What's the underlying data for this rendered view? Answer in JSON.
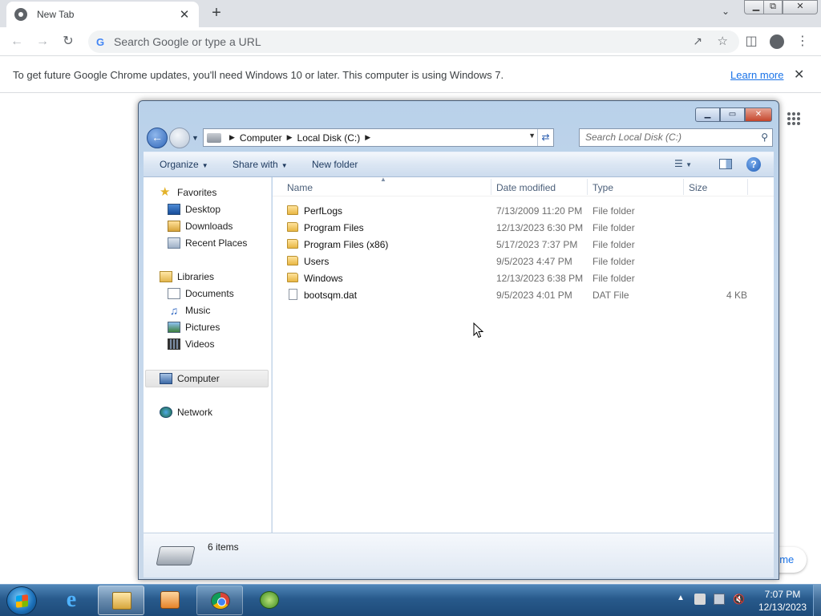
{
  "chrome": {
    "tab_title": "New Tab",
    "tab_close": "✕",
    "new_tab": "+",
    "omnibox_placeholder": "Search Google or type a URL",
    "omnibox_g": "G",
    "window_buttons": {
      "minimize": "▁",
      "restore": "⧉",
      "close": "✕"
    },
    "infobar": {
      "message": "To get future Google Chrome updates, you'll need Windows 10 or later. This computer is using Windows 7.",
      "link": "Learn more",
      "close": "✕"
    },
    "customize_chip": "ome"
  },
  "explorer": {
    "caption": {
      "minimize": "▁",
      "maximize": "▭",
      "close": "✕"
    },
    "address": {
      "crumbs": [
        "Computer",
        "Local Disk (C:)"
      ]
    },
    "search_placeholder": "Search Local Disk (C:)",
    "commands": {
      "organize": "Organize",
      "share_with": "Share with",
      "new_folder": "New folder"
    },
    "nav": {
      "favorites": "Favorites",
      "desktop": "Desktop",
      "downloads": "Downloads",
      "recent_places": "Recent Places",
      "libraries": "Libraries",
      "documents": "Documents",
      "music": "Music",
      "pictures": "Pictures",
      "videos": "Videos",
      "computer": "Computer",
      "network": "Network"
    },
    "columns": {
      "name": "Name",
      "date": "Date modified",
      "type": "Type",
      "size": "Size"
    },
    "files": [
      {
        "name": "PerfLogs",
        "date": "7/13/2009 11:20 PM",
        "type": "File folder",
        "size": "",
        "icon": "folder-icon"
      },
      {
        "name": "Program Files",
        "date": "12/13/2023 6:30 PM",
        "type": "File folder",
        "size": "",
        "icon": "folder-icon"
      },
      {
        "name": "Program Files (x86)",
        "date": "5/17/2023 7:37 PM",
        "type": "File folder",
        "size": "",
        "icon": "folder-icon"
      },
      {
        "name": "Users",
        "date": "9/5/2023 4:47 PM",
        "type": "File folder",
        "size": "",
        "icon": "folder-icon"
      },
      {
        "name": "Windows",
        "date": "12/13/2023 6:38 PM",
        "type": "File folder",
        "size": "",
        "icon": "folder-icon"
      },
      {
        "name": "bootsqm.dat",
        "date": "9/5/2023 4:01 PM",
        "type": "DAT File",
        "size": "4 KB",
        "icon": "file-icon"
      }
    ],
    "item_count": "6 items"
  },
  "taskbar": {
    "clock_time": "7:07 PM",
    "clock_date": "12/13/2023"
  }
}
